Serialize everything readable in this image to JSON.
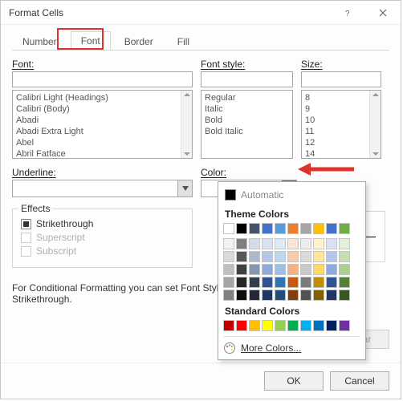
{
  "dialog": {
    "title": "Format Cells"
  },
  "tabs": [
    {
      "label": "Number"
    },
    {
      "label": "Font"
    },
    {
      "label": "Border"
    },
    {
      "label": "Fill"
    }
  ],
  "labels": {
    "font": "Font:",
    "font_style": "Font style:",
    "size": "Size:",
    "underline": "Underline:",
    "color": "Color:",
    "effects": "Effects"
  },
  "font_list": [
    "Calibri Light (Headings)",
    "Calibri (Body)",
    "Abadi",
    "Abadi Extra Light",
    "Abel",
    "Abril Fatface"
  ],
  "style_list": [
    "Regular",
    "Italic",
    "Bold",
    "Bold Italic"
  ],
  "size_list": [
    "8",
    "9",
    "10",
    "11",
    "12",
    "14"
  ],
  "underline_value": "",
  "color_value": "Automatic",
  "effects": {
    "strikethrough": "Strikethrough",
    "superscript": "Superscript",
    "subscript": "Subscript"
  },
  "note": "For Conditional Formatting you can set Font Style, Font Color, Underline, and Strikethrough.",
  "color_dropdown": {
    "automatic": "Automatic",
    "theme_head": "Theme Colors",
    "standard_head": "Standard Colors",
    "more": "More Colors...",
    "theme_row": [
      "#ffffff",
      "#000000",
      "#44546a",
      "#4472c4",
      "#5b9bd5",
      "#ed7d31",
      "#a5a5a5",
      "#ffc000",
      "#4472c4",
      "#70ad47"
    ],
    "theme_tints": [
      [
        "#f2f2f2",
        "#7f7f7f",
        "#d6dce5",
        "#d9e1f2",
        "#deebf7",
        "#fbe5d6",
        "#ededed",
        "#fff2cc",
        "#d9e1f2",
        "#e2efda"
      ],
      [
        "#d9d9d9",
        "#595959",
        "#adb9ca",
        "#b4c6e7",
        "#bdd7ee",
        "#f8cbad",
        "#dbdbdb",
        "#ffe699",
        "#b4c6e7",
        "#c6e0b4"
      ],
      [
        "#bfbfbf",
        "#404040",
        "#8497b0",
        "#8ea9db",
        "#9bc2e6",
        "#f4b183",
        "#c9c9c9",
        "#ffd966",
        "#8ea9db",
        "#a9d08e"
      ],
      [
        "#a6a6a6",
        "#262626",
        "#333f4f",
        "#305496",
        "#2f75b5",
        "#c65911",
        "#7b7b7b",
        "#bf8f00",
        "#305496",
        "#548235"
      ],
      [
        "#808080",
        "#0d0d0d",
        "#222b35",
        "#203764",
        "#1f4e78",
        "#833c0c",
        "#525252",
        "#806000",
        "#203764",
        "#375623"
      ]
    ],
    "standard_row": [
      "#c00000",
      "#ff0000",
      "#ffc000",
      "#ffff00",
      "#92d050",
      "#00b050",
      "#00b0f0",
      "#0070c0",
      "#002060",
      "#7030a0"
    ]
  },
  "buttons": {
    "clear": "Clear",
    "ok": "OK",
    "cancel": "Cancel"
  }
}
